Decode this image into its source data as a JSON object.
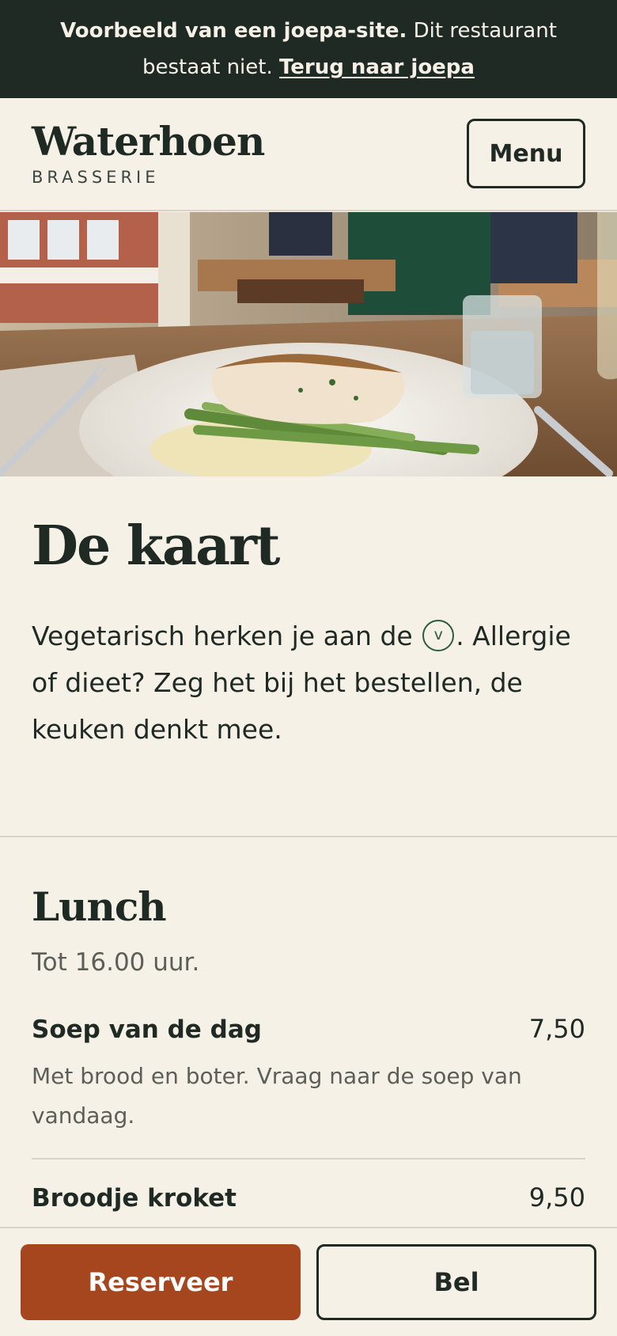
{
  "banner": {
    "bold": "Voorbeeld van een joepa-site.",
    "text": " Dit restaurant bestaat niet. ",
    "link": "Terug naar joepa"
  },
  "header": {
    "brand_name": "Waterhoen",
    "brand_sub": "BRASSERIE",
    "menu_label": "Menu"
  },
  "hero": {
    "image_desc": "hero-photo"
  },
  "intro": {
    "title": "De kaart",
    "text_before": "Vegetarisch herken je aan de ",
    "veg_symbol": "v",
    "text_after": ". Allergie of dieet? Zeg het bij het bestellen, de keuken denkt mee."
  },
  "lunch": {
    "title": "Lunch",
    "subtitle": "Tot 16.00 uur.",
    "items": [
      {
        "name": "Soep van de dag",
        "price": "7,50",
        "desc": "Met brood en boter. Vraag naar de soep van vandaag."
      },
      {
        "name": "Broodje kroket",
        "price": "9,50",
        "desc": ""
      }
    ]
  },
  "actions": {
    "reserve_label": "Reserveer",
    "call_label": "Bel"
  },
  "colors": {
    "background": "#f6f1e7",
    "dark": "#1f2a24",
    "accent": "#a5461f",
    "veg": "#2f5a42"
  }
}
